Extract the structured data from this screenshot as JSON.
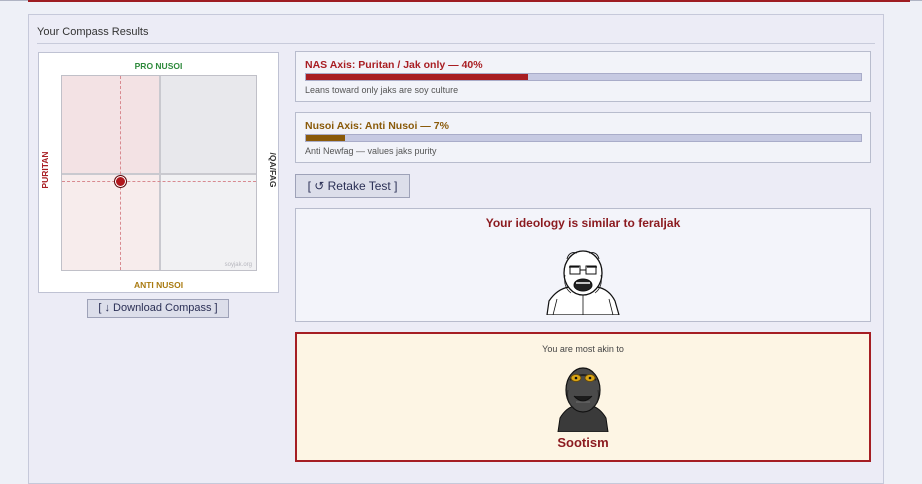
{
  "panel": {
    "title": "Your Compass Results"
  },
  "compass": {
    "top_label": "PRO NUSOI",
    "bottom_label": "ANTI NUSOI",
    "left_label": "PURITAN",
    "right_label": "/QA/FAG",
    "watermark": "soyjak.org",
    "download_label": "[ ↓ Download Compass ]"
  },
  "axes": [
    {
      "title": "NAS Axis: Puritan / Jak only — 40%",
      "percent": 40,
      "color": "#a81d22",
      "description": "Leans toward only jaks are soy culture"
    },
    {
      "title": "Nusoi Axis: Anti Nusoi — 7%",
      "percent": 7,
      "color": "#8a5a0a",
      "description": "Anti Newfag — values jaks purity"
    }
  ],
  "retake_label": "[ ↺ Retake Test ]",
  "ideology": {
    "title": "Your ideology is similar to feraljak"
  },
  "akin": {
    "intro": "You are most akin to",
    "name": "Sootism"
  }
}
